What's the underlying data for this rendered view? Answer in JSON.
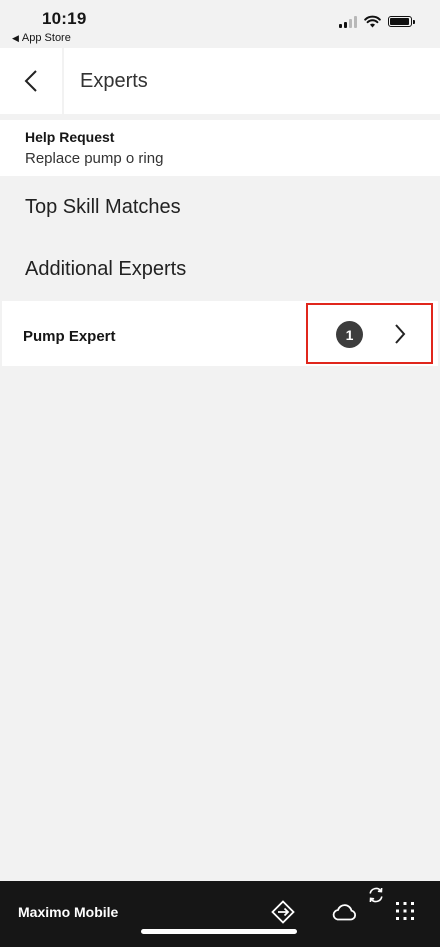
{
  "status_bar": {
    "time": "10:19",
    "back_app_label": "App Store",
    "icons": [
      "cellular-signal-icon",
      "wifi-icon",
      "battery-icon"
    ]
  },
  "header": {
    "title": "Experts",
    "back_icon": "chevron-left-icon"
  },
  "help_request": {
    "label": "Help Request",
    "value": "Replace pump o ring"
  },
  "sections": {
    "top_skill": "Top Skill Matches",
    "additional": "Additional Experts"
  },
  "experts": [
    {
      "name": "Pump Expert",
      "count": "1",
      "icon": "chevron-right-icon",
      "highlight_color": "#e0261c"
    }
  ],
  "bottom_bar": {
    "app_name": "Maximo Mobile",
    "icons": [
      "navigator-icon",
      "cloud-icon",
      "sync-icon",
      "app-grid-icon"
    ]
  },
  "colors": {
    "background": "#f2f2f2",
    "surface": "#ffffff",
    "bottom_bar": "#161616",
    "badge": "#3d3d3d",
    "highlight": "#e0261c"
  }
}
